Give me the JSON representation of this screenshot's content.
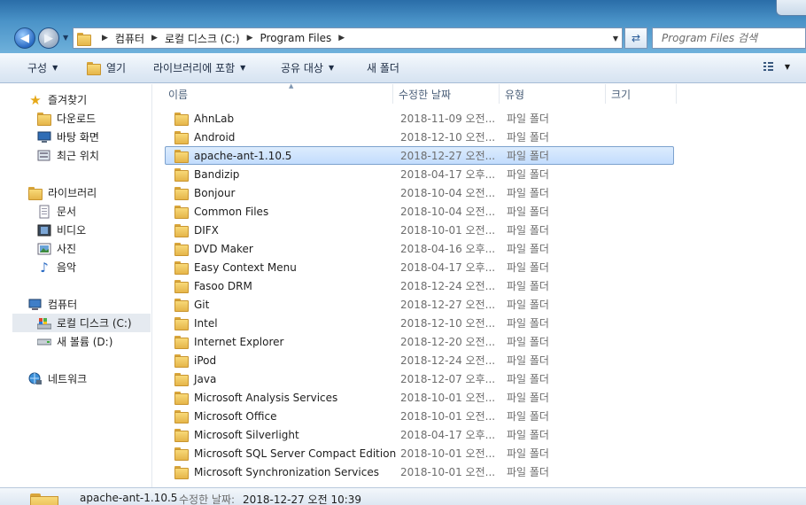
{
  "address": {
    "crumbs": [
      "컴퓨터",
      "로컬 디스크 (C:)",
      "Program Files"
    ]
  },
  "search": {
    "placeholder": "Program Files 검색"
  },
  "toolbar": {
    "organize": "구성",
    "open": "열기",
    "include_library": "라이브러리에 포함",
    "share": "공유 대상",
    "new_folder": "새 폴더"
  },
  "nav": {
    "favorites": "즐겨찾기",
    "downloads": "다운로드",
    "desktop": "바탕 화면",
    "recent": "최근 위치",
    "libraries": "라이브러리",
    "documents": "문서",
    "videos": "비디오",
    "pictures": "사진",
    "music": "음악",
    "computer": "컴퓨터",
    "local_disk": "로컬 디스크 (C:)",
    "new_volume": "새 볼륨 (D:)",
    "network": "네트워크"
  },
  "columns": {
    "name": "이름",
    "date": "수정한 날짜",
    "type": "유형",
    "size": "크기"
  },
  "files": [
    {
      "name": "AhnLab",
      "date": "2018-11-09 오전...",
      "type": "파일 폴더"
    },
    {
      "name": "Android",
      "date": "2018-12-10 오전...",
      "type": "파일 폴더"
    },
    {
      "name": "apache-ant-1.10.5",
      "date": "2018-12-27 오전...",
      "type": "파일 폴더"
    },
    {
      "name": "Bandizip",
      "date": "2018-04-17 오후...",
      "type": "파일 폴더"
    },
    {
      "name": "Bonjour",
      "date": "2018-10-04 오전...",
      "type": "파일 폴더"
    },
    {
      "name": "Common Files",
      "date": "2018-10-04 오전...",
      "type": "파일 폴더"
    },
    {
      "name": "DIFX",
      "date": "2018-10-01 오전...",
      "type": "파일 폴더"
    },
    {
      "name": "DVD Maker",
      "date": "2018-04-16 오후...",
      "type": "파일 폴더"
    },
    {
      "name": "Easy Context Menu",
      "date": "2018-04-17 오후...",
      "type": "파일 폴더"
    },
    {
      "name": "Fasoo DRM",
      "date": "2018-12-24 오전...",
      "type": "파일 폴더"
    },
    {
      "name": "Git",
      "date": "2018-12-27 오전...",
      "type": "파일 폴더"
    },
    {
      "name": "Intel",
      "date": "2018-12-10 오전...",
      "type": "파일 폴더"
    },
    {
      "name": "Internet Explorer",
      "date": "2018-12-20 오전...",
      "type": "파일 폴더"
    },
    {
      "name": "iPod",
      "date": "2018-12-24 오전...",
      "type": "파일 폴더"
    },
    {
      "name": "Java",
      "date": "2018-12-07 오후...",
      "type": "파일 폴더"
    },
    {
      "name": "Microsoft Analysis Services",
      "date": "2018-10-01 오전...",
      "type": "파일 폴더"
    },
    {
      "name": "Microsoft Office",
      "date": "2018-10-01 오전...",
      "type": "파일 폴더"
    },
    {
      "name": "Microsoft Silverlight",
      "date": "2018-04-17 오후...",
      "type": "파일 폴더"
    },
    {
      "name": "Microsoft SQL Server Compact Edition",
      "date": "2018-10-01 오전...",
      "type": "파일 폴더"
    },
    {
      "name": "Microsoft Synchronization Services",
      "date": "2018-10-01 오전...",
      "type": "파일 폴더"
    }
  ],
  "selected_index": 2,
  "status": {
    "name": "apache-ant-1.10.5",
    "modified_label": "수정한 날짜:",
    "modified_value": "2018-12-27 오전 10:39"
  },
  "colors": {
    "selection": "#cce1fb",
    "toolbar": "#e3ecf6",
    "glass": "#4a93c8"
  }
}
